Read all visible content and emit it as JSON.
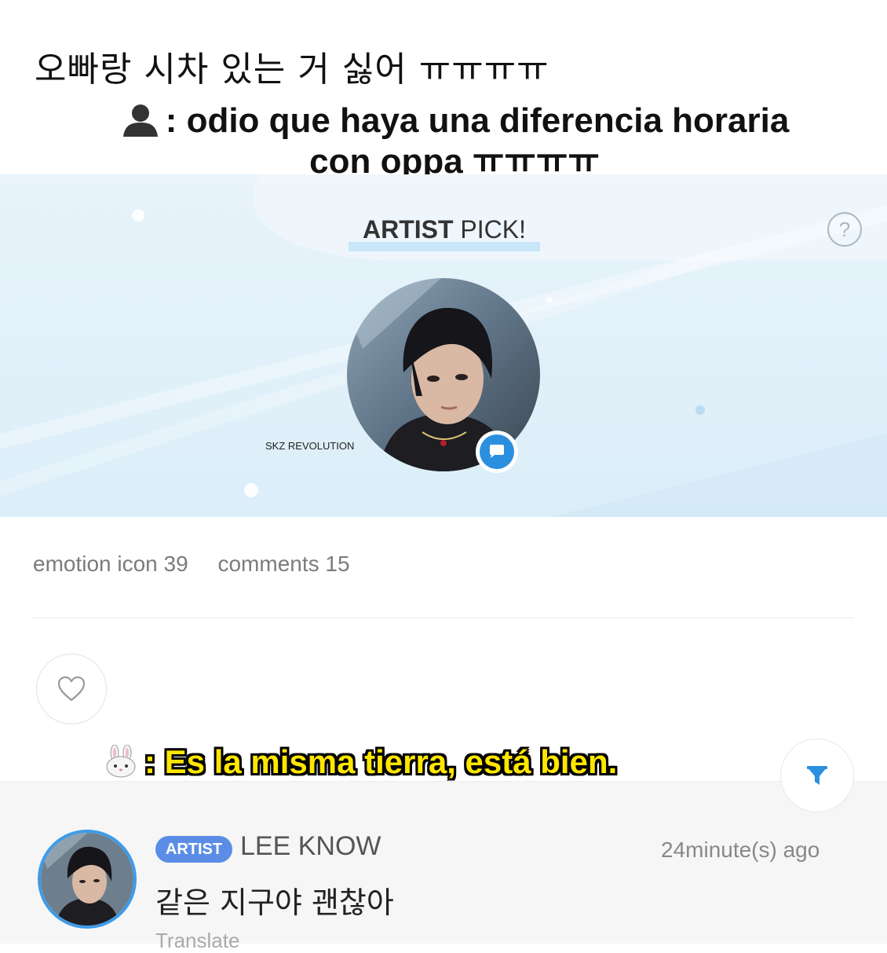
{
  "captions": {
    "korean": "오빠랑 시차 있는 거 싫어 ㅠㅠㅠㅠ",
    "spanish_line1": ": odio que haya una diferencia horaria",
    "spanish_line2": "con oppa ㅠㅠㅠㅠ",
    "person_icon": "person-silhouette-icon"
  },
  "banner": {
    "title_bold": "ARTIST",
    "title_rest": " PICK!",
    "help_label": "?",
    "watermark": "SKZ REVOLUTION",
    "badge_icon": "chat-bubble-icon"
  },
  "stats": {
    "emotion": "emotion icon 39",
    "comments": "comments 15"
  },
  "subtitle": {
    "icon": "rabbit-icon",
    "text": ": Es la misma tierra, está bien."
  },
  "comment": {
    "badge": "ARTIST",
    "author": "LEE KNOW",
    "time": "24minute(s) ago",
    "text": "같은 지구야 괜찮아",
    "translate": "Translate"
  },
  "colors": {
    "accent": "#2b8fe0",
    "badge": "#5b8de6",
    "subtitle_fill": "#ffe600"
  }
}
